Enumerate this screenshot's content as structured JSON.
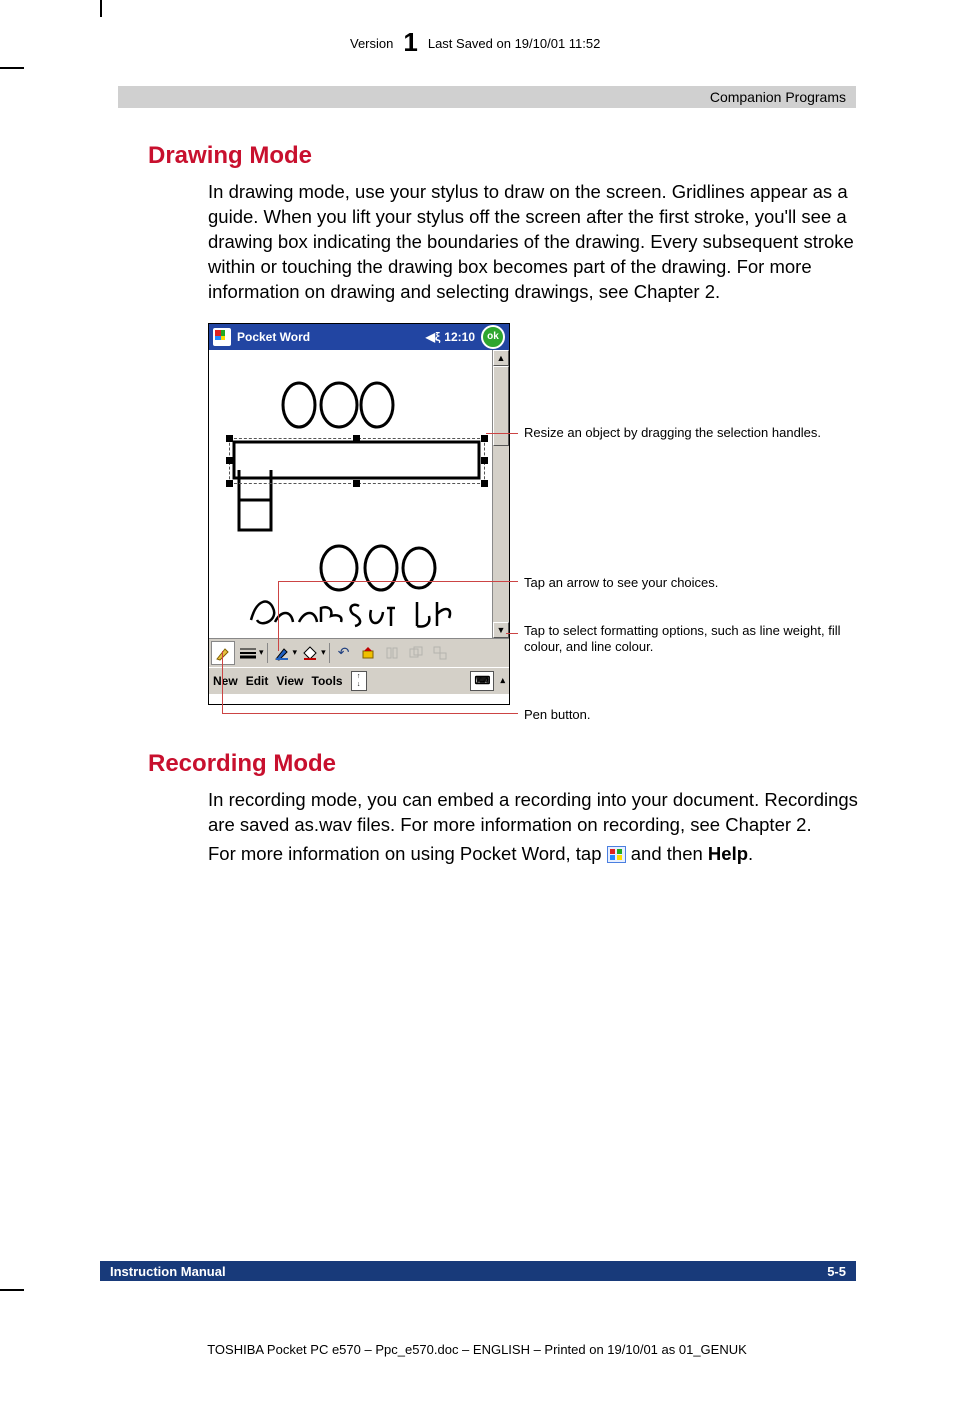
{
  "header": {
    "version_label": "Version",
    "version_number": "1",
    "saved_label": "Last Saved on 19/10/01 11:52"
  },
  "section_bar": "Companion Programs",
  "drawing_mode": {
    "heading": "Drawing Mode",
    "para": "In drawing mode, use your stylus to draw on the screen. Gridlines appear as a guide. When you lift your stylus off the screen after the first stroke, you'll see a drawing box indicating the boundaries of the drawing. Every subsequent stroke within or touching the drawing box becomes part of the drawing. For more information on drawing and selecting drawings, see Chapter 2."
  },
  "screenshot": {
    "title": "Pocket Word",
    "time": "12:10",
    "ok": "ok",
    "menu": {
      "new": "New",
      "edit": "Edit",
      "view": "View",
      "tools": "Tools"
    },
    "handwriting_top": "O O O",
    "handwriting_bottom": "O O O",
    "handwriting_label": "Room Set UP"
  },
  "callouts": {
    "c1": "Resize an object by dragging the selection handles.",
    "c2": "Tap an arrow to see your choices.",
    "c3": "Tap to select formatting options, such as line weight, fill colour, and line colour.",
    "c4": "Pen button."
  },
  "recording_mode": {
    "heading": "Recording Mode",
    "para1": "In recording mode, you can embed a recording into your document. Recordings are saved as.wav files. For more information on recording, see Chapter 2.",
    "para2a": "For more information on using Pocket Word, tap ",
    "para2b": " and then ",
    "help": "Help",
    "period": "."
  },
  "footer": {
    "left": "Instruction Manual",
    "right": "5-5"
  },
  "footnote": "TOSHIBA Pocket PC e570  – Ppc_e570.doc – ENGLISH – Printed on 19/10/01 as 01_GENUK"
}
